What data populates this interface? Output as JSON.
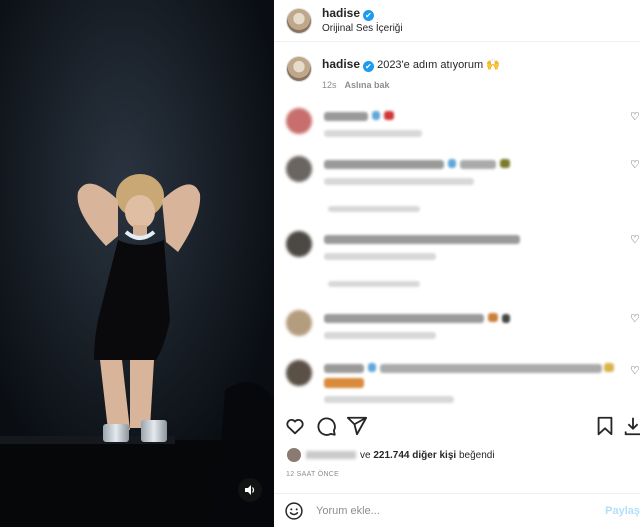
{
  "header": {
    "username": "hadise",
    "verified_mark": "✔",
    "audio_label": "Orijinal Ses İçeriği"
  },
  "caption": {
    "username": "hadise",
    "text": "2023'e adım atıyorum 🙌",
    "time": "12s",
    "see_original": "Aslına bak"
  },
  "likes": {
    "text_prefix": "ve",
    "count_text": "221.744 diğer kişi",
    "suffix": "beğendi"
  },
  "timestamp": "12 SAAT ÖNCE",
  "comment_box": {
    "placeholder": "Yorum ekle...",
    "post_label": "Paylaş"
  },
  "icons": {
    "audio": "speaker-icon",
    "like": "heart-icon",
    "comment": "comment-icon",
    "share": "send-icon",
    "save": "bookmark-icon",
    "download": "download-icon",
    "emoji": "smile-icon"
  },
  "colors": {
    "verified": "#1d9bf0",
    "link_disabled": "#b2dffc",
    "muted": "#8e8e8e"
  }
}
